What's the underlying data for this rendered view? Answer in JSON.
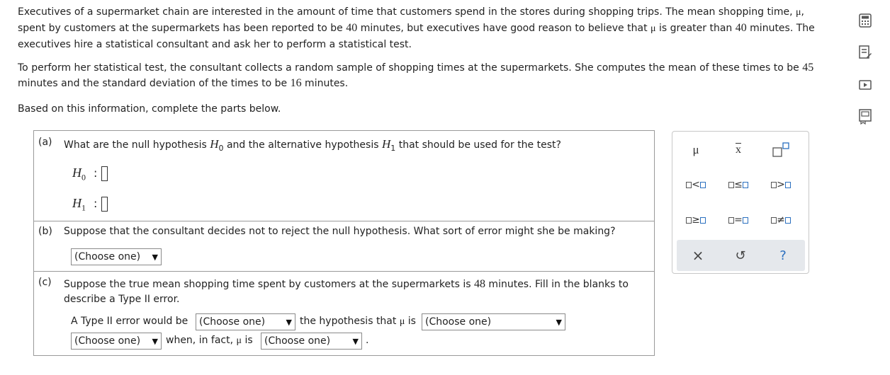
{
  "intro": {
    "p1_a": "Executives of a supermarket chain are interested in the amount of time that customers spend in the stores during shopping trips. The mean shopping time, ",
    "mu": "μ",
    "p1_b": ", spent by customers at the supermarkets has been reported to be ",
    "reported_mean": "40",
    "p1_c": " minutes, but executives have good reason to believe that ",
    "p1_d": " is greater than ",
    "p1_e": " minutes. The executives hire a statistical consultant and ask her to perform a statistical test.",
    "p2_a": "To perform her statistical test, the consultant collects a random sample of shopping times at the supermarkets. She computes the mean of these times to be ",
    "sample_mean": "45",
    "p2_b": " minutes and the standard deviation of the times to be ",
    "sample_sd": "16",
    "p2_c": " minutes.",
    "p3": "Based on this information, complete the parts below."
  },
  "part_a": {
    "label": "(a)",
    "q1": "What are the null hypothesis ",
    "h0": "H",
    "h0_sub": "0",
    "q2": " and the alternative hypothesis ",
    "h1": "H",
    "h1_sub": "1",
    "q3": " that should be used for the test?",
    "colon": ":"
  },
  "part_b": {
    "label": "(b)",
    "question": "Suppose that the consultant decides not to reject the null hypothesis. What sort of error might she be making?",
    "dropdown": "(Choose one)"
  },
  "part_c": {
    "label": "(c)",
    "q1": "Suppose the true mean shopping time spent by customers at the supermarkets is ",
    "true_mean": "48",
    "q2": " minutes. Fill in the blanks to describe a Type II error.",
    "line1_a": "A Type II error would be",
    "dd1": "(Choose one)",
    "line1_b": "the hypothesis that ",
    "mu": "μ",
    "line1_c": " is",
    "dd2": "(Choose one)",
    "dd3": "(Choose one)",
    "line2_a": "when, in fact, ",
    "line2_b": " is",
    "dd4": "(Choose one)",
    "period": "."
  },
  "palette": {
    "mu": "μ",
    "xbar": "x",
    "lt": "<",
    "le": "≤",
    "gt": ">",
    "ge": "≥",
    "eq": "=",
    "ne": "≠",
    "close": "×",
    "reset": "↺",
    "help": "?"
  },
  "colors": {
    "accent": "#2a6fbf",
    "palette_bar": "#e5e8ec"
  },
  "icons": [
    "calculator-icon",
    "notes-icon",
    "video-icon",
    "textbook-icon",
    "undo-icon",
    "help-icon",
    "close-icon"
  ]
}
